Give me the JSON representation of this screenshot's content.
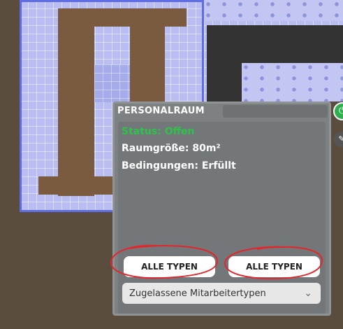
{
  "room_panel": {
    "title": "PERSONALRAUM",
    "status": "Status: Offen",
    "size": "Raumgröße: 80m²",
    "conditions": "Bedingungen: Erfüllt",
    "button_left": "ALLE TYPEN",
    "button_right": "ALLE TYPEN",
    "dropdown_label": "Zugelassene Mitarbeitertypen"
  },
  "colors": {
    "status_green": "#2ec24c",
    "annotation_red": "#e3262c"
  },
  "icons": {
    "side_button": "power-icon",
    "side_button_2": "wrench-icon",
    "dropdown": "chevron-down-icon"
  }
}
